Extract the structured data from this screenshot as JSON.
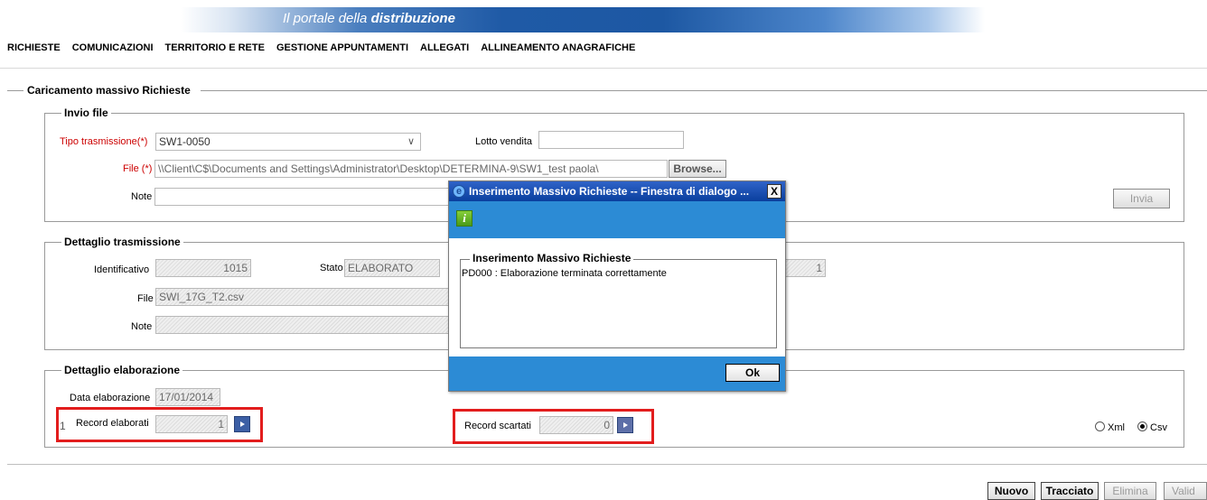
{
  "banner": {
    "title_prefix": "Il portale della",
    "title_bold": "distribuzione"
  },
  "menu": [
    "RICHIESTE",
    "COMUNICAZIONI",
    "TERRITORIO E RETE",
    "GESTIONE APPUNTAMENTI",
    "ALLEGATI",
    "ALLINEAMENTO ANAGRAFICHE"
  ],
  "main": {
    "section_title": "Caricamento massivo Richieste",
    "invio_file": {
      "legend": "Invio file",
      "tipo_trasmissione_label": "Tipo trasmissione(*)",
      "tipo_trasmissione_value": "SW1-0050",
      "lotto_vendita_label": "Lotto vendita",
      "lotto_vendita_value": "",
      "file_label": "File (*)",
      "file_value": "\\\\Client\\C$\\Documents and Settings\\Administrator\\Desktop\\DETERMINA-9\\SW1_test paola\\",
      "browse_label": "Browse...",
      "note_label": "Note",
      "note_value": "",
      "invia_label": "Invia"
    },
    "dettaglio_trasmissione": {
      "legend": "Dettaglio trasmissione",
      "identificativo_label": "Identificativo",
      "identificativo_value": "1015",
      "stato_label": "Stato",
      "stato_value": "ELABORATO",
      "right_value": "1",
      "file_label": "File",
      "file_value": "SWI_17G_T2.csv",
      "note_label": "Note",
      "note_value": ""
    },
    "dettaglio_elaborazione": {
      "legend": "Dettaglio elaborazione",
      "data_label": "Data elaborazione",
      "data_value": "17/01/2014",
      "record_elaborati_prefix": "1",
      "record_elaborati_label": "Record elaborati",
      "record_elaborati_value": "1",
      "record_scartati_label": "Record scartati",
      "record_scartati_value": "0",
      "format_xml_label": "Xml",
      "format_csv_label": "Csv",
      "format_selected": "Csv"
    }
  },
  "footer_buttons": {
    "nuovo": "Nuovo",
    "tracciato": "Tracciato",
    "elimina": "Elimina",
    "valida": "Valid"
  },
  "dialog": {
    "title": "Inserimento Massivo Richieste -- Finestra di dialogo ...",
    "info_icon_glyph": "i",
    "close_glyph": "X",
    "fieldset_legend": "Inserimento Massivo Richieste",
    "message": "PD000 : Elaborazione terminata correttamente",
    "ok_label": "Ok"
  },
  "colors": {
    "accent_blue": "#2c8bd5",
    "title_blue": "#0a3f9e",
    "required_red": "#cc0000",
    "highlight_red": "#e21d1d"
  }
}
